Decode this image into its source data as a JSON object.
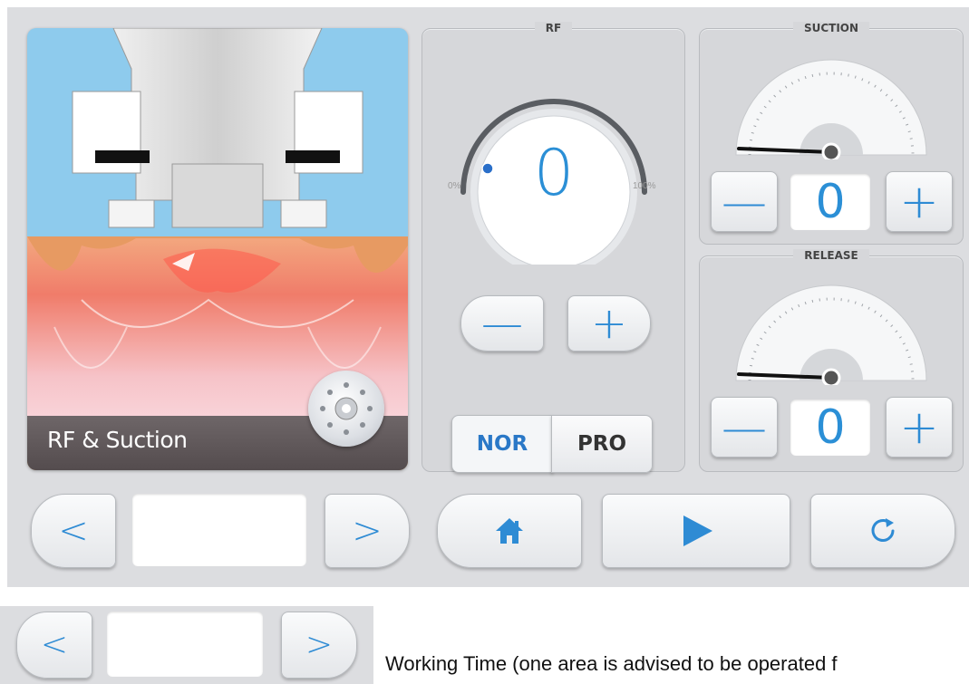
{
  "image_caption": "RF & Suction",
  "rf": {
    "title": "RF",
    "value": "0",
    "min_label": "0%",
    "max_label": "100%",
    "modes": [
      "NOR",
      "PRO"
    ],
    "active_mode": "NOR"
  },
  "suction": {
    "title": "SUCTION",
    "value": "0"
  },
  "release": {
    "title": "RELEASE",
    "value": "0"
  },
  "icons": {
    "prev": "chevron-left-icon",
    "next": "chevron-right-icon",
    "home": "home-icon",
    "play": "play-icon",
    "reset": "refresh-icon"
  },
  "colors": {
    "accent": "#2e8bd4",
    "panel": "#dcdde0"
  },
  "footer_text": "Working Time (one area is advised to be operated f"
}
